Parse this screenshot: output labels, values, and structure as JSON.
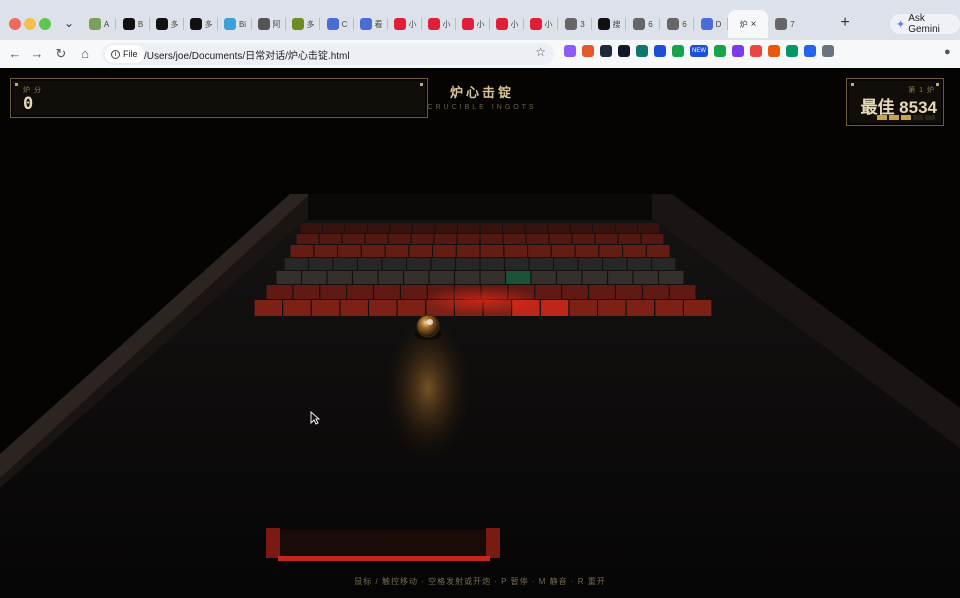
{
  "browser": {
    "tabs": [
      {
        "label": "A",
        "color": "#7aa15b"
      },
      {
        "label": "B",
        "color": "#111111"
      },
      {
        "label": "多",
        "color": "#111111"
      },
      {
        "label": "多",
        "color": "#111111"
      },
      {
        "label": "Bi",
        "color": "#3ea0da"
      },
      {
        "label": "阿",
        "color": "#555555"
      },
      {
        "label": "多",
        "color": "#6b8e23"
      },
      {
        "label": "C",
        "color": "#4b6bd6"
      },
      {
        "label": "看",
        "color": "#4b6bd6"
      },
      {
        "label": "小",
        "color": "#e0203a"
      },
      {
        "label": "小",
        "color": "#e0203a"
      },
      {
        "label": "小",
        "color": "#e0203a"
      },
      {
        "label": "小",
        "color": "#e0203a"
      },
      {
        "label": "小",
        "color": "#e0203a"
      },
      {
        "label": "3",
        "color": "#666666"
      },
      {
        "label": "搜",
        "color": "#111111"
      },
      {
        "label": "6",
        "color": "#666666"
      },
      {
        "label": "6",
        "color": "#666666"
      },
      {
        "label": "D",
        "color": "#4b6bd6"
      }
    ],
    "active_tab": {
      "label": "炉",
      "close": "×"
    },
    "last_tab": {
      "label": "7",
      "color": "#666666"
    },
    "new_tab": "+",
    "gemini_label": "Ask Gemini",
    "file_chip": "File",
    "url": "/Users/joe/Documents/日常对话/炉心击锭.html",
    "extensions": [
      "#8b5cf6",
      "#e05a2b",
      "#1f2937",
      "#111827",
      "#0f766e",
      "#1d4ed8",
      "#16a34a",
      "#111827",
      "#16a34a",
      "#7c3aed",
      "#ef4444",
      "#ea580c",
      "#059669",
      "#2563eb",
      "#6b7280"
    ],
    "new_badge": "NEW"
  },
  "game": {
    "score_label": "炉 分",
    "score": "0",
    "title": "炉心击锭",
    "subtitle": "CRUCIBLE INGOTS",
    "level_label": "第 1 炉",
    "best": "最佳 8534",
    "lives_total": 5,
    "lives_filled": 3,
    "hint": "鼠标 / 触控移动 · 空格发射或开炮 · P 暂停 · M 静音 · R 重开",
    "colors": {
      "ember": "#b3261a",
      "gold": "#c9a24e",
      "brass": "#d7c39a"
    }
  }
}
